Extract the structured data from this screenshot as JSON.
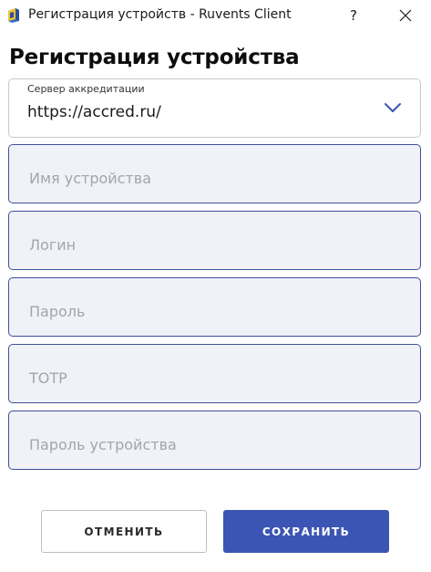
{
  "window": {
    "title": "Регистрация устройств - Ruvents Client",
    "help_label": "?"
  },
  "form": {
    "heading": "Регистрация устройства",
    "server": {
      "label": "Сервер аккредитации",
      "value": "https://accred.ru/"
    },
    "fields": {
      "device_name": {
        "placeholder": "Имя устройства",
        "value": ""
      },
      "login": {
        "placeholder": "Логин",
        "value": ""
      },
      "password": {
        "placeholder": "Пароль",
        "value": ""
      },
      "totp": {
        "placeholder": "TOTP",
        "value": ""
      },
      "device_password": {
        "placeholder": "Пароль устройства",
        "value": ""
      }
    }
  },
  "actions": {
    "cancel_label": "ОТМЕНИТЬ",
    "save_label": "СОХРАНИТЬ"
  },
  "colors": {
    "accent": "#3b55b4",
    "field_border": "#3d4f9c",
    "field_background": "#f1f2f8",
    "placeholder": "#a3a5ad"
  },
  "icons": {
    "app": "app-icon",
    "help": "question-mark",
    "close": "close-icon",
    "dropdown": "chevron-down-icon"
  }
}
